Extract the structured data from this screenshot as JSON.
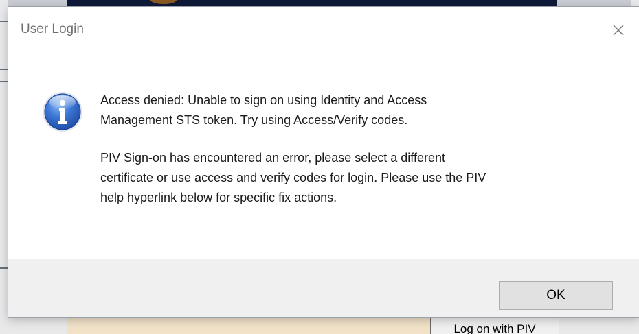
{
  "background": {
    "partial_button_label": "Log on with PIV"
  },
  "dialog": {
    "title": "User Login",
    "close_icon": "close-icon",
    "icon": "information-icon",
    "message_paragraphs": [
      "Access denied: Unable to sign on using Identity and Access\nManagement STS token. Try using Access/Verify codes.",
      "PIV Sign-on has encountered an error, please select a different\ncertificate or use access and verify codes for login. Please use the PIV\nhelp hyperlink below for specific fix actions."
    ],
    "ok_label": "OK"
  },
  "colors": {
    "title_text": "#6f6f6f",
    "footer_background": "#f0f0f0",
    "button_face": "#e1e1e1",
    "info_icon_blue": "#2f66c7"
  }
}
